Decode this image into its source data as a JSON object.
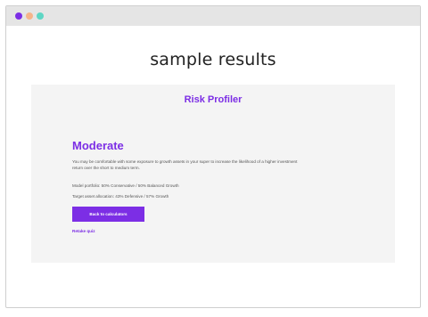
{
  "colors": {
    "accent": "#7c2ee5",
    "dot1": "#7c2ee5",
    "dot2": "#f5b48a",
    "dot3": "#5ed6c4"
  },
  "page": {
    "heading": "sample results"
  },
  "profiler": {
    "title": "Risk Profiler",
    "result": "Moderate",
    "description": "You may be comfortable with some exposure to growth assets in your super to increase the likelihood of a higher investment return over the short to medium term.",
    "model_portfolio": "Model portfolio: 50% Conservative / 50% Balanced Growth",
    "target_allocation": "Target asset allocation: 43% Defensive / 57% Growth",
    "back_button": "Back to calculators",
    "retake_link": "Retake quiz"
  }
}
